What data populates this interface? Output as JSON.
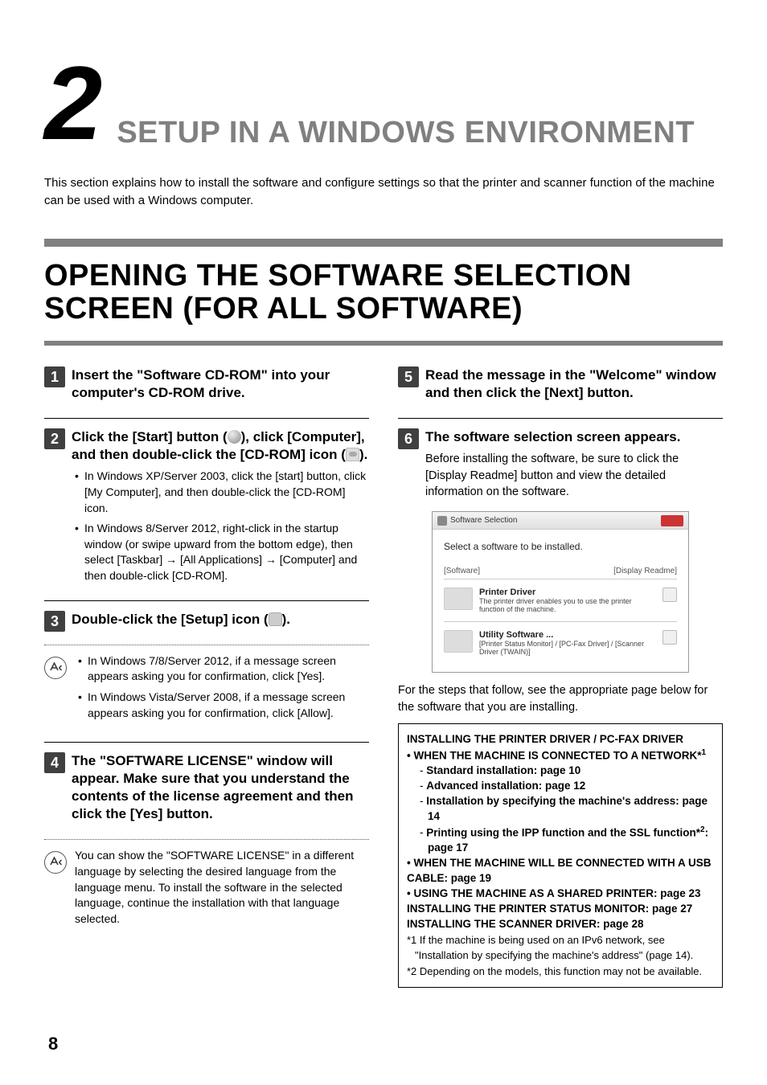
{
  "chapter": {
    "number": "2",
    "title": "SETUP IN A WINDOWS ENVIRONMENT"
  },
  "intro": "This section explains how to install the software and configure settings so that the printer and scanner function of the machine can be used with a Windows computer.",
  "section_title": "OPENING THE SOFTWARE SELECTION SCREEN (FOR ALL SOFTWARE)",
  "steps": {
    "s1": {
      "num": "1",
      "title": "Insert the \"Software CD-ROM\" into your computer's CD-ROM drive."
    },
    "s2": {
      "num": "2",
      "title_pre": "Click the [Start] button (",
      "title_mid": "), click [Computer], and then double-click the [CD-ROM] icon (",
      "title_post": ").",
      "b1": "In Windows XP/Server 2003, click the [start] button, click [My Computer], and then double-click the [CD-ROM] icon.",
      "b2": "In Windows 8/Server 2012, right-click in the startup window (or swipe upward from the bottom edge), then select [Taskbar] → [All Applications] → [Computer] and then double-click [CD-ROM]."
    },
    "s3": {
      "num": "3",
      "title_pre": "Double-click the [Setup] icon (",
      "title_post": ").",
      "n1": "In Windows 7/8/Server 2012, if a message screen appears asking you for confirmation, click [Yes].",
      "n2": "In Windows Vista/Server 2008, if a message screen appears asking you for confirmation, click [Allow]."
    },
    "s4": {
      "num": "4",
      "title": "The \"SOFTWARE LICENSE\" window will appear. Make sure that you understand the contents of the license agreement and then click the [Yes] button.",
      "note": "You can show the \"SOFTWARE LICENSE\" in a different language by selecting the desired language from the language menu. To install the software in the selected language, continue the installation with that language selected."
    },
    "s5": {
      "num": "5",
      "title": "Read the message in the \"Welcome\" window and then click the [Next] button."
    },
    "s6": {
      "num": "6",
      "title": "The software selection screen appears.",
      "desc": "Before installing the software, be sure to click the [Display Readme] button and view the detailed information on the software."
    }
  },
  "screenshot": {
    "titlebar": "Software Selection",
    "headline": "Select a software to be installed.",
    "col_left": "[Software]",
    "col_right": "[Display Readme]",
    "item1_title": "Printer Driver",
    "item1_desc": "The printer driver enables you to use the printer function of the machine.",
    "item2_title": "Utility Software ...",
    "item2_desc": "[Printer Status Monitor] / [PC-Fax Driver] / [Scanner Driver (TWAIN)]"
  },
  "after_shot": "For the steps that follow, see the appropriate page below for the software that you are installing.",
  "refbox": {
    "h1": "INSTALLING THE PRINTER DRIVER / PC-FAX DRIVER",
    "b1": "• WHEN THE MACHINE IS CONNECTED TO A NETWORK*",
    "b1sup": "1",
    "i1": "Standard installation: page 10",
    "i2": "Advanced installation: page 12",
    "i3": "Installation by specifying the machine's address: page 14",
    "i4a": "Printing using the IPP function and the SSL function*",
    "i4sup": "2",
    "i4b": ": page 17",
    "b2": "• WHEN THE MACHINE WILL BE CONNECTED WITH A USB CABLE: page 19",
    "b3": "• USING THE MACHINE AS A SHARED PRINTER: page 23",
    "h2": "INSTALLING THE PRINTER STATUS MONITOR: page 27",
    "h3": "INSTALLING THE SCANNER DRIVER: page 28",
    "fn1": "*1 If the machine is being used on an IPv6 network, see \"Installation by specifying the machine's address\" (page 14).",
    "fn2": "*2 Depending on the models, this function may not be available."
  },
  "page_number": "8"
}
